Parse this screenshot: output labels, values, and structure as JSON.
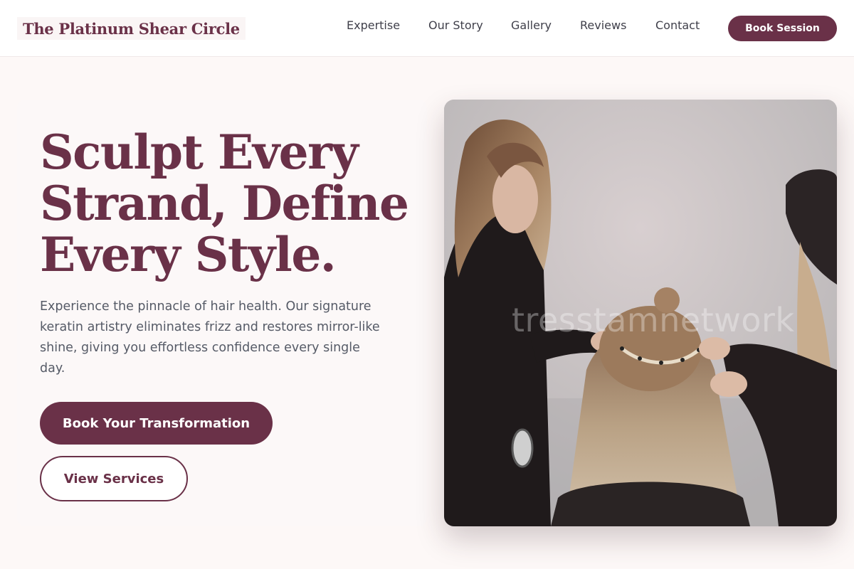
{
  "brand": {
    "name": "The Platinum Shear Circle"
  },
  "nav": {
    "links": [
      "Expertise",
      "Our Story",
      "Gallery",
      "Reviews",
      "Contact"
    ],
    "cta": "Book Session"
  },
  "hero": {
    "headline_lines": [
      "Sculpt Every",
      "Strand, Define",
      "Every Style."
    ],
    "lead": "Experience the pinnacle of hair health. Our signature keratin artistry eliminates frizz and restores mirror-like shine, giving you effortless confidence every single day.",
    "primary_cta": "Book Your Transformation",
    "secondary_cta": "View Services"
  },
  "photo": {
    "watermark": "tresstamnetwork",
    "alt": "Stylists applying hair extensions to a client"
  },
  "colors": {
    "brand": "#6a3148",
    "page_bg": "#fdf8f7",
    "text_muted": "#555a66"
  }
}
